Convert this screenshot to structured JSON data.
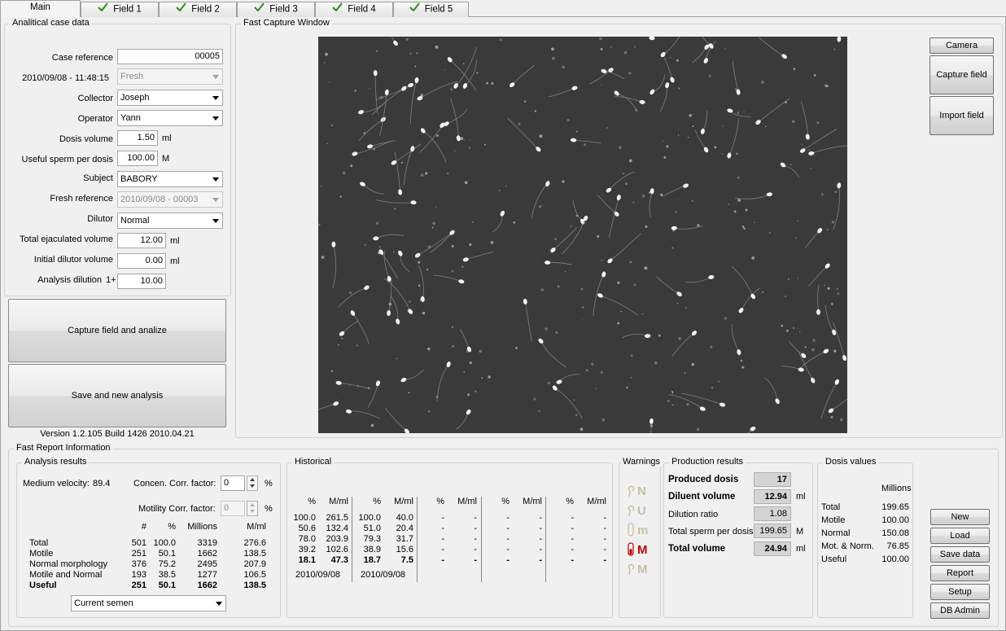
{
  "tabs": [
    {
      "label": "Main",
      "checked": false
    },
    {
      "label": "Field 1",
      "checked": true
    },
    {
      "label": "Field 2",
      "checked": true
    },
    {
      "label": "Field 3",
      "checked": true
    },
    {
      "label": "Field 4",
      "checked": true
    },
    {
      "label": "Field 5",
      "checked": true
    }
  ],
  "case": {
    "title": "Analitical case data",
    "case_reference_label": "Case reference",
    "case_reference": "00005",
    "datetime": "2010/09/08 - 11:48:15",
    "type_value": "Fresh",
    "collector_label": "Collector",
    "collector": "Joseph",
    "operator_label": "Operator",
    "operator": "Yann",
    "dosis_volume_label": "Dosis volume",
    "dosis_volume": "1.50",
    "dosis_volume_unit": "ml",
    "useful_sperm_label": "Useful sperm per dosis",
    "useful_sperm": "100.00",
    "useful_sperm_unit": "M",
    "subject_label": "Subject",
    "subject": "BABORY",
    "fresh_ref_label": "Fresh reference",
    "fresh_ref": "2010/09/08 - 00003",
    "dilutor_label": "Dilutor",
    "dilutor": "Normal",
    "total_ejac_label": "Total ejaculated volume",
    "total_ejac": "12.00",
    "total_ejac_unit": "ml",
    "initial_dilutor_label": "Initial dilutor volume",
    "initial_dilutor": "0.00",
    "initial_dilutor_unit": "ml",
    "analysis_dilution_label": "Analysis dilution",
    "analysis_dilution_prefix": "1+",
    "analysis_dilution": "10.00"
  },
  "buttons": {
    "capture_analyze": "Capture field and analize",
    "save_new": "Save and new analysis",
    "camera": "Camera",
    "capture_field": "Capture field",
    "import_field": "Import field",
    "new": "New",
    "load": "Load",
    "save_data": "Save data",
    "report": "Report",
    "setup": "Setup",
    "db_admin": "DB Admin"
  },
  "version": "Version 1.2.105 Build 1426 2010.04.21",
  "capture_window_title": "Fast Capture Window",
  "report_title": "Fast Report Information",
  "analysis": {
    "title": "Analysis results",
    "medium_velocity_label": "Medium velocity:",
    "medium_velocity": "89.4",
    "concen_label": "Concen. Corr. factor:",
    "concen_value": "0",
    "concen_unit": "%",
    "motility_label": "Motility Corr. factor:",
    "motility_value": "0",
    "motility_unit": "%",
    "headers": [
      "#",
      "%",
      "Millions",
      "M/ml"
    ],
    "rows": [
      {
        "label": "Total",
        "n": "501",
        "pct": "100.0",
        "millions": "3319",
        "mml": "276.6",
        "bold": false
      },
      {
        "label": "Motile",
        "n": "251",
        "pct": "50.1",
        "millions": "1662",
        "mml": "138.5",
        "bold": false
      },
      {
        "label": "Normal morphology",
        "n": "376",
        "pct": "75.2",
        "millions": "2495",
        "mml": "207.9",
        "bold": false
      },
      {
        "label": "Motile and Normal",
        "n": "193",
        "pct": "38.5",
        "millions": "1277",
        "mml": "106.5",
        "bold": false
      },
      {
        "label": "Useful",
        "n": "251",
        "pct": "50.1",
        "millions": "1662",
        "mml": "138.5",
        "bold": true
      }
    ],
    "semen_select": "Current semen"
  },
  "historical": {
    "title": "Historical",
    "columns": [
      {
        "pct_header": "%",
        "mml_header": "M/ml",
        "pct": [
          "100.0",
          "50.6",
          "78.0",
          "39.2",
          "18.1"
        ],
        "mml": [
          "261.5",
          "132.4",
          "203.9",
          "102.6",
          "47.3"
        ],
        "date": "2010/09/08"
      },
      {
        "pct_header": "%",
        "mml_header": "M/ml",
        "pct": [
          "100.0",
          "51.0",
          "79.3",
          "38.9",
          "18.7"
        ],
        "mml": [
          "40.0",
          "20.4",
          "31.7",
          "15.6",
          "7.5"
        ],
        "date": "2010/09/08"
      },
      {
        "pct_header": "%",
        "mml_header": "M/ml",
        "pct": [
          "-",
          "-",
          "-",
          "-",
          "-"
        ],
        "mml": [
          "-",
          "-",
          "-",
          "-",
          "-"
        ],
        "date": ""
      },
      {
        "pct_header": "%",
        "mml_header": "M/ml",
        "pct": [
          "-",
          "-",
          "-",
          "-",
          "-"
        ],
        "mml": [
          "-",
          "-",
          "-",
          "-",
          "-"
        ],
        "date": ""
      },
      {
        "pct_header": "%",
        "mml_header": "M/ml",
        "pct": [
          "-",
          "-",
          "-",
          "-",
          "-"
        ],
        "mml": [
          "-",
          "-",
          "-",
          "-",
          "-"
        ],
        "date": ""
      }
    ]
  },
  "warnings": {
    "title": "Warnings",
    "items": [
      {
        "letter": "N",
        "active": false,
        "color": "#c8c0a4"
      },
      {
        "letter": "U",
        "active": false,
        "color": "#c8c0a4"
      },
      {
        "letter": "m",
        "active": false,
        "color": "#c8c0a4"
      },
      {
        "letter": "M",
        "active": true,
        "color": "#c00000"
      },
      {
        "letter": "M",
        "active": false,
        "color": "#c8c0a4"
      }
    ]
  },
  "production": {
    "title": "Production results",
    "produced_label": "Produced dosis",
    "produced": "17",
    "diluent_label": "Diluent volume",
    "diluent": "12.94",
    "diluent_unit": "ml",
    "ratio_label": "Dilution ratio",
    "ratio": "1.08",
    "total_sperm_label": "Total sperm per dosis",
    "total_sperm": "199.65",
    "total_sperm_unit": "M",
    "total_volume_label": "Total volume",
    "total_volume": "24.94",
    "total_volume_unit": "ml"
  },
  "dosis": {
    "title": "Dosis values",
    "header": "Millions",
    "rows": [
      {
        "label": "Total",
        "value": "199.65"
      },
      {
        "label": "Motile",
        "value": "100.00"
      },
      {
        "label": "Normal",
        "value": "150.08"
      },
      {
        "label": "Mot. & Norm.",
        "value": "76.85"
      },
      {
        "label": "Useful",
        "value": "100.00"
      }
    ]
  }
}
